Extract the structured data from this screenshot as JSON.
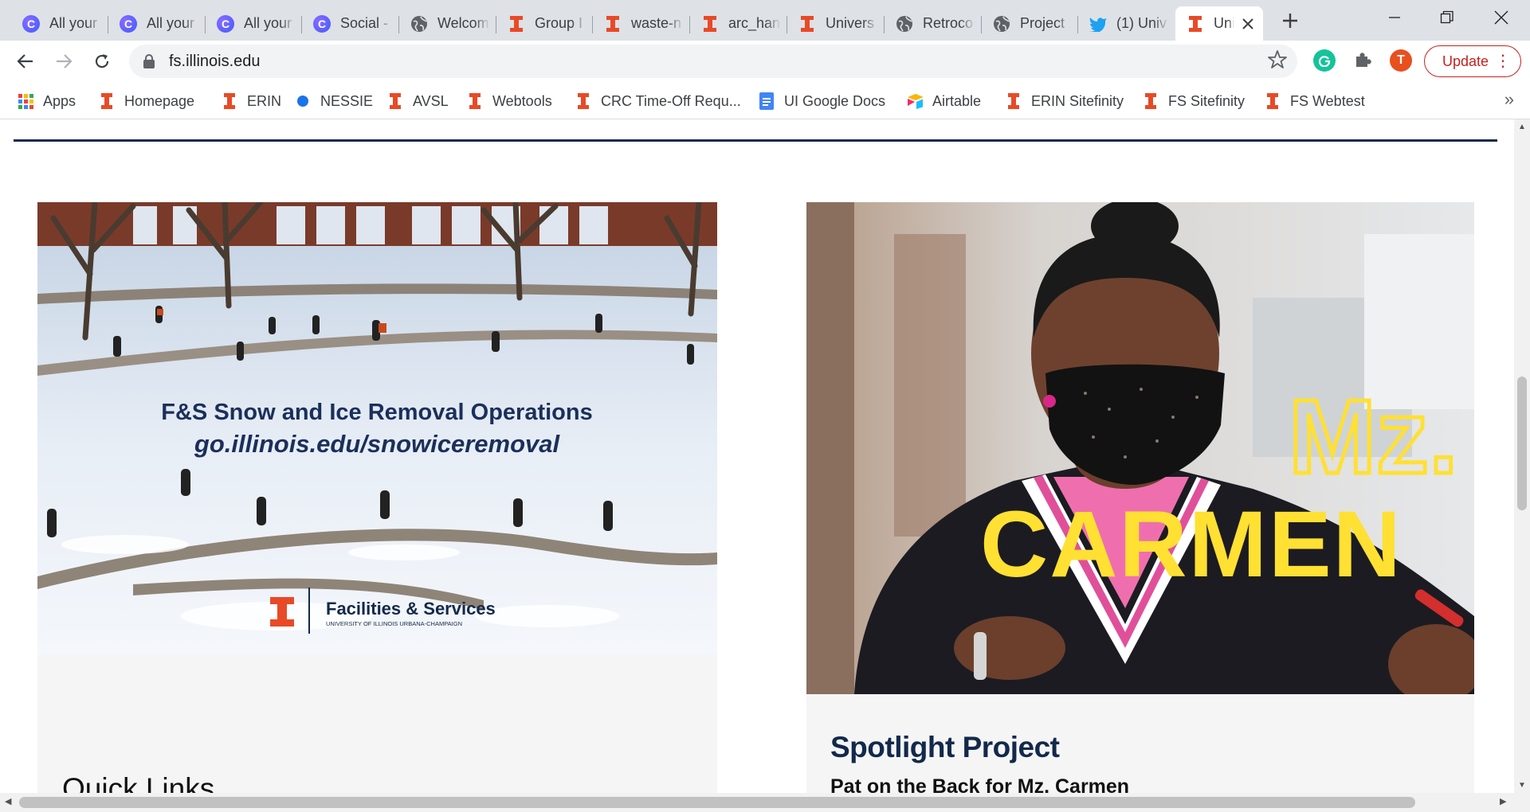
{
  "tabs": [
    {
      "title": "All your",
      "favicon": "c-circle-icon"
    },
    {
      "title": "All your",
      "favicon": "c-circle-icon"
    },
    {
      "title": "All your",
      "favicon": "c-circle-icon"
    },
    {
      "title": "Social -",
      "favicon": "c-circle-icon"
    },
    {
      "title": "Welcom",
      "favicon": "globe-icon"
    },
    {
      "title": "Group I",
      "favicon": "illinois-i-icon"
    },
    {
      "title": "waste-n",
      "favicon": "illinois-i-icon"
    },
    {
      "title": "arc_han",
      "favicon": "illinois-i-icon"
    },
    {
      "title": "Univers",
      "favicon": "illinois-i-icon"
    },
    {
      "title": "Retroco",
      "favicon": "globe-icon"
    },
    {
      "title": "Project",
      "favicon": "globe-icon"
    },
    {
      "title": "(1) Univ",
      "favicon": "twitter-icon"
    },
    {
      "title": "Uni",
      "favicon": "illinois-i-icon",
      "active": true
    }
  ],
  "toolbar": {
    "url": "fs.illinois.edu",
    "profile_initial": "T",
    "update_label": "Update"
  },
  "bookmarks": [
    {
      "label": "Apps",
      "icon": "apps-grid-icon"
    },
    {
      "label": "Homepage",
      "icon": "illinois-i-icon"
    },
    {
      "label": "ERIN",
      "icon": "illinois-i-icon"
    },
    {
      "label": "NESSIE",
      "icon": "blue-dot-icon"
    },
    {
      "label": "AVSL",
      "icon": "illinois-i-icon"
    },
    {
      "label": "Webtools",
      "icon": "illinois-i-icon"
    },
    {
      "label": "CRC Time-Off Requ...",
      "icon": "illinois-i-icon"
    },
    {
      "label": "UI Google Docs",
      "icon": "google-docs-icon"
    },
    {
      "label": "Airtable",
      "icon": "airtable-icon"
    },
    {
      "label": "ERIN Sitefinity",
      "icon": "illinois-i-icon"
    },
    {
      "label": "FS Sitefinity",
      "icon": "illinois-i-icon"
    },
    {
      "label": "FS Webtest",
      "icon": "illinois-i-icon"
    }
  ],
  "page": {
    "snow_card": {
      "image_headline": "F&S Snow and Ice Removal Operations",
      "image_url_text": "go.illinois.edu/snowiceremoval",
      "logo_name": "Facilities & Services",
      "logo_sub": "UNIVERSITY OF ILLINOIS URBANA-CHAMPAIGN",
      "section_title": "Quick Links"
    },
    "spotlight_card": {
      "image_text_1": "Mz.",
      "image_text_2": "CARMEN",
      "title": "Spotlight Project",
      "subtitle": "Pat on the Back for Mz. Carmen"
    }
  },
  "colors": {
    "illinois_orange": "#e84a27",
    "illinois_blue": "#13294b",
    "update_red": "#c5221f"
  }
}
